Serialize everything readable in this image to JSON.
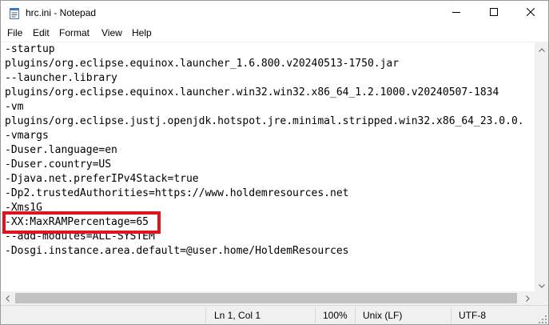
{
  "window": {
    "title": "hrc.ini - Notepad"
  },
  "menu": {
    "file": "File",
    "edit": "Edit",
    "format": "Format",
    "view": "View",
    "help": "Help"
  },
  "editor": {
    "lines": [
      "-startup",
      "plugins/org.eclipse.equinox.launcher_1.6.800.v20240513-1750.jar",
      "--launcher.library",
      "plugins/org.eclipse.equinox.launcher.win32.win32.x86_64_1.2.1000.v20240507-1834",
      "-vm",
      "plugins/org.eclipse.justj.openjdk.hotspot.jre.minimal.stripped.win32.x86_64_23.0.0.",
      "-vmargs",
      "-Duser.language=en",
      "-Duser.country=US",
      "-Djava.net.preferIPv4Stack=true",
      "-Dp2.trustedAuthorities=https://www.holdemresources.net",
      "-Xms1G",
      "-XX:MaxRAMPercentage=65",
      "--add-modules=ALL-SYSTEM",
      "-Dosgi.instance.area.default=@user.home/HoldemResources"
    ],
    "highlight_color": "#e0141e"
  },
  "status": {
    "position": "Ln 1, Col 1",
    "zoom": "100%",
    "line_ending": "Unix (LF)",
    "encoding": "UTF-8"
  },
  "icons": {
    "app": "notepad-icon",
    "minimize": "minimize-icon",
    "maximize": "maximize-icon",
    "close": "close-icon"
  }
}
